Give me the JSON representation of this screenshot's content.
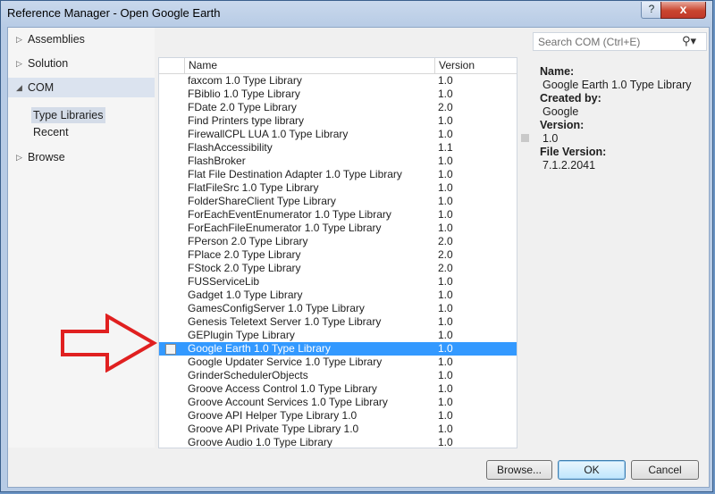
{
  "window": {
    "title": "Reference Manager - Open Google Earth",
    "help_icon": "?",
    "close_icon": "x"
  },
  "nav": {
    "items": [
      {
        "label": "Assemblies"
      },
      {
        "label": "Solution"
      },
      {
        "label": "COM"
      },
      {
        "label": "Browse"
      }
    ],
    "com_sub": [
      {
        "label": "Type Libraries"
      },
      {
        "label": "Recent"
      }
    ]
  },
  "list": {
    "headers": {
      "name": "Name",
      "version": "Version"
    },
    "rows": [
      {
        "name": "faxcom 1.0 Type Library",
        "version": "1.0"
      },
      {
        "name": "FBiblio 1.0 Type Library",
        "version": "1.0"
      },
      {
        "name": "FDate 2.0 Type Library",
        "version": "2.0"
      },
      {
        "name": "Find Printers type library",
        "version": "1.0"
      },
      {
        "name": "FirewallCPL LUA 1.0 Type Library",
        "version": "1.0"
      },
      {
        "name": "FlashAccessibility",
        "version": "1.1"
      },
      {
        "name": "FlashBroker",
        "version": "1.0"
      },
      {
        "name": "Flat File Destination Adapter 1.0 Type Library",
        "version": "1.0"
      },
      {
        "name": "FlatFileSrc 1.0 Type Library",
        "version": "1.0"
      },
      {
        "name": "FolderShareClient Type Library",
        "version": "1.0"
      },
      {
        "name": "ForEachEventEnumerator 1.0 Type Library",
        "version": "1.0"
      },
      {
        "name": "ForEachFileEnumerator 1.0 Type Library",
        "version": "1.0"
      },
      {
        "name": "FPerson 2.0 Type Library",
        "version": "2.0"
      },
      {
        "name": "FPlace 2.0 Type Library",
        "version": "2.0"
      },
      {
        "name": "FStock 2.0 Type Library",
        "version": "2.0"
      },
      {
        "name": "FUSServiceLib",
        "version": "1.0"
      },
      {
        "name": "Gadget 1.0 Type Library",
        "version": "1.0"
      },
      {
        "name": "GamesConfigServer 1.0 Type Library",
        "version": "1.0"
      },
      {
        "name": "Genesis Teletext Server 1.0 Type Library",
        "version": "1.0"
      },
      {
        "name": "GEPlugin Type Library",
        "version": "1.0"
      },
      {
        "name": "Google Earth 1.0 Type Library",
        "version": "1.0",
        "selected": true
      },
      {
        "name": "Google Updater Service 1.0 Type Library",
        "version": "1.0"
      },
      {
        "name": "GrinderSchedulerObjects",
        "version": "1.0"
      },
      {
        "name": "Groove Access Control 1.0 Type Library",
        "version": "1.0"
      },
      {
        "name": "Groove Account Services 1.0 Type Library",
        "version": "1.0"
      },
      {
        "name": "Groove API Helper Type Library 1.0",
        "version": "1.0"
      },
      {
        "name": "Groove API Private Type Library 1.0",
        "version": "1.0"
      },
      {
        "name": "Groove Audio 1.0 Type Library",
        "version": "1.0"
      }
    ]
  },
  "search": {
    "placeholder": "Search COM (Ctrl+E)"
  },
  "details": {
    "name_label": "Name:",
    "name_value": "Google Earth 1.0 Type Library",
    "created_label": "Created by:",
    "created_value": "Google",
    "version_label": "Version:",
    "version_value": "1.0",
    "file_version_label": "File Version:",
    "file_version_value": "7.1.2.2041"
  },
  "buttons": {
    "browse": "Browse...",
    "ok": "OK",
    "cancel": "Cancel"
  },
  "colors": {
    "selection": "#3399ff",
    "annotation_arrow": "#e02020"
  }
}
